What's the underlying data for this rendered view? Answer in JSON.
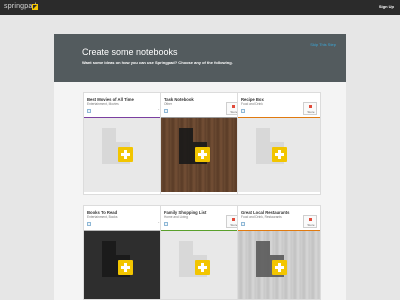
{
  "topbar": {
    "logo_text": "springpad",
    "signup_label": "Sign Up"
  },
  "hero": {
    "title": "Create some notebooks",
    "subtitle": "Want some ideas on how you can use Springpad? Choose any of the following.",
    "skip_label": "Skip This Step"
  },
  "cards": [
    {
      "title": "Best Movies of All Time",
      "category": "Entertainment, Movies",
      "store_label": "",
      "stripe_color": "#7b3fa0",
      "art": "light"
    },
    {
      "title": "Task Notebook",
      "category": "Other",
      "store_label": "Store",
      "stripe_color": "#9b9b9b",
      "art": "wood"
    },
    {
      "title": "Recipe Box",
      "category": "Food and Drink",
      "store_label": "Store",
      "stripe_color": "#e07a10",
      "art": "light"
    },
    {
      "title": "Books To Read",
      "category": "Entertainment, Books",
      "store_label": "",
      "stripe_color": "#b8b8b8",
      "art": "dark"
    },
    {
      "title": "Family Shopping List",
      "category": "Home and Living",
      "store_label": "Store",
      "stripe_color": "#5aa02c",
      "art": "light"
    },
    {
      "title": "Great Local Restaurants",
      "category": "Food and Drink, Restaurants",
      "store_label": "Store",
      "stripe_color": "#e07a10",
      "art": "greywood"
    }
  ],
  "icons": {
    "more": "ellipsis-icon",
    "notebook": "notebook-icon",
    "add": "plus-icon"
  },
  "colors": {
    "accent": "#f2c500",
    "hero_bg": "#535b5e",
    "link": "#3aa7d8"
  }
}
